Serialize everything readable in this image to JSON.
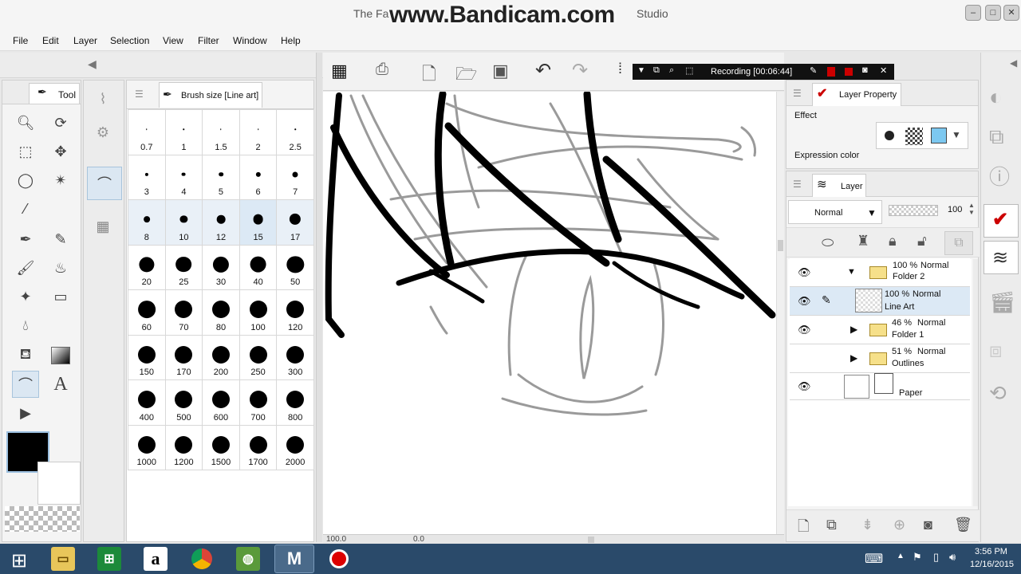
{
  "window": {
    "title_left": "The Fa",
    "title_right": "Studio",
    "watermark": "www.Bandicam.com",
    "recording": "Recording [00:06:44]"
  },
  "menu": [
    "File",
    "Edit",
    "Layer",
    "Selection",
    "View",
    "Filter",
    "Window",
    "Help"
  ],
  "tool_panel": {
    "tab_label": "Tool"
  },
  "brush_panel": {
    "title": "Brush size [Line art]",
    "sizes": [
      [
        "0.7",
        "1",
        "1.5",
        "2",
        "2.5"
      ],
      [
        "3",
        "4",
        "5",
        "6",
        "7"
      ],
      [
        "8",
        "10",
        "12",
        "15",
        "17"
      ],
      [
        "20",
        "25",
        "30",
        "40",
        "50"
      ],
      [
        "60",
        "70",
        "80",
        "100",
        "120"
      ],
      [
        "150",
        "170",
        "200",
        "250",
        "300"
      ],
      [
        "400",
        "500",
        "600",
        "700",
        "800"
      ],
      [
        "1000",
        "1200",
        "1500",
        "1700",
        "2000"
      ]
    ],
    "selected": "15"
  },
  "layer_property": {
    "title": "Layer Property",
    "effect_label": "Effect",
    "expression_label": "Expression color"
  },
  "layer_panel": {
    "title": "Layer",
    "blend_mode": "Normal",
    "opacity": "100",
    "layers": [
      {
        "pct": "100 %",
        "mode": "Normal",
        "name": "Folder 2",
        "type": "folder-open",
        "visible": true
      },
      {
        "pct": "100 %",
        "mode": "Normal",
        "name": "Line Art",
        "type": "raster",
        "visible": true,
        "selected": true
      },
      {
        "pct": "46 %",
        "mode": "Normal",
        "name": "Folder 1",
        "type": "folder",
        "visible": true
      },
      {
        "pct": "51 %",
        "mode": "Normal",
        "name": "Outlines",
        "type": "folder",
        "visible": false
      },
      {
        "pct": "",
        "mode": "",
        "name": "Paper",
        "type": "paper",
        "visible": true
      }
    ]
  },
  "canvas_status": {
    "zoom": "100.0",
    "angle": "0.0"
  },
  "taskbar": {
    "time": "3:56 PM",
    "date": "12/16/2015"
  },
  "colors": {
    "taskbar": "#2a4a6a",
    "selection": "#dce9f5",
    "accent_red": "#cc0000"
  }
}
